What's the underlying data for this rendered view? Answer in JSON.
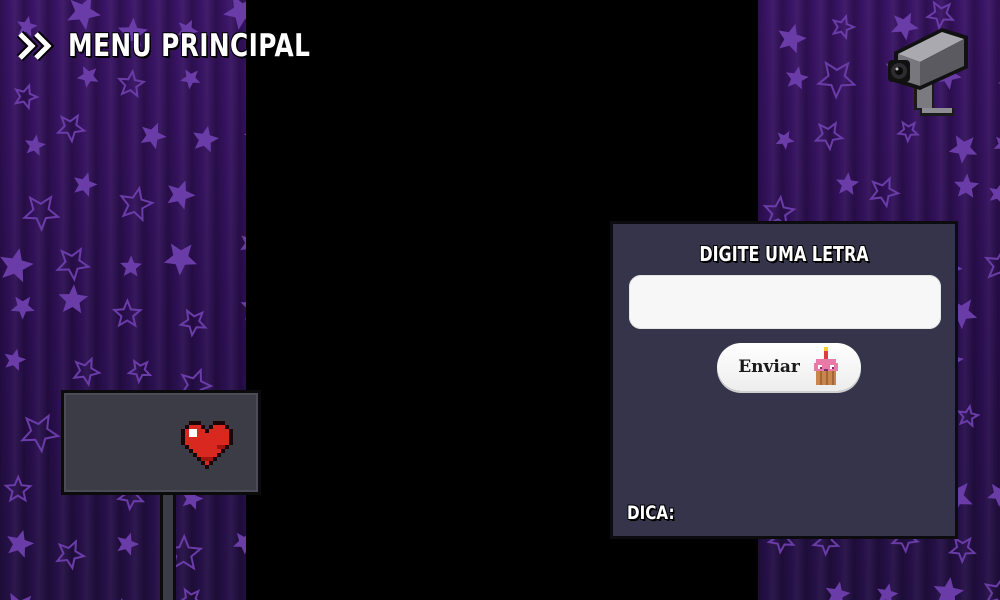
{
  "nav": {
    "menu_label": "MENU PRINCIPAL",
    "menu_icon": "double-chevron-right-icon"
  },
  "camera": {
    "icon": "security-camera-icon"
  },
  "sign": {
    "icon": "pixel-heart-icon"
  },
  "panel": {
    "title": "DIGITE UMA LETRA",
    "input_value": "",
    "input_placeholder": "",
    "send_label": "Enviar",
    "send_icon": "cupcake-icon",
    "hint_label": "DICA:",
    "hint_value": ""
  },
  "colors": {
    "curtain": "#2c0f52",
    "star": "#6a3ca8",
    "panel": "#35344b",
    "heart": "#d9281f",
    "cupcake_frosting": "#e97aa8"
  }
}
